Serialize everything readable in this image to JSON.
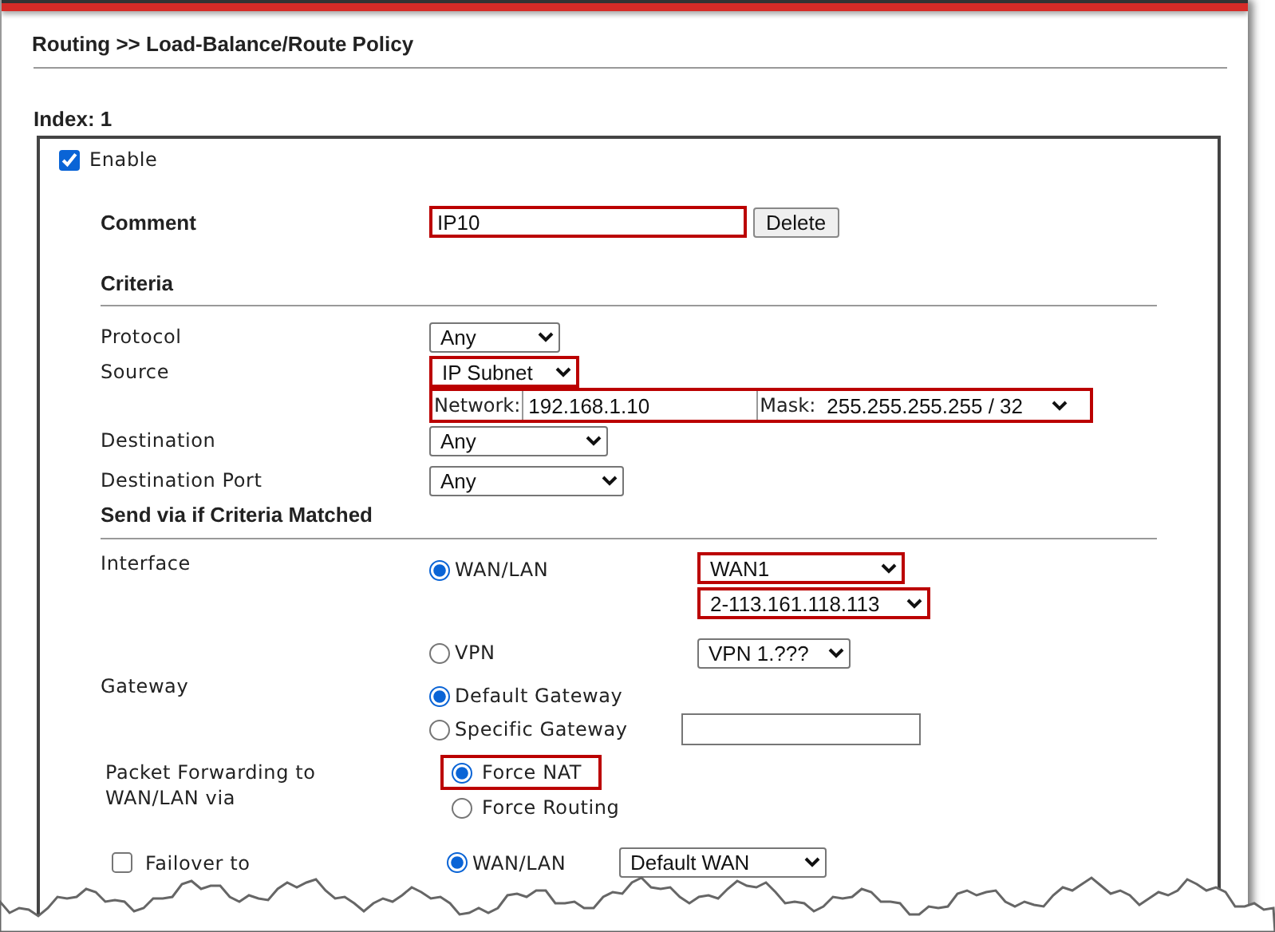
{
  "header": {
    "title": "Routing >> Load-Balance/Route Policy"
  },
  "index_label": "Index: 1",
  "enable": {
    "label": "Enable",
    "checked": true
  },
  "comment": {
    "label": "Comment",
    "value": "IP10",
    "highlighted": true,
    "button": "Delete"
  },
  "criteria": {
    "heading": "Criteria",
    "protocol": {
      "label": "Protocol",
      "value": "Any",
      "highlighted": false
    },
    "source": {
      "label": "Source",
      "value": "IP Subnet",
      "highlighted": true
    },
    "network": {
      "label": "Network:",
      "value": "192.168.1.10",
      "mask_label": "Mask:",
      "mask_value": "255.255.255.255 / 32",
      "highlighted": true
    },
    "destination": {
      "label": "Destination",
      "value": "Any",
      "highlighted": false
    },
    "destination_port": {
      "label": "Destination Port",
      "value": "Any",
      "highlighted": false
    }
  },
  "send_via": {
    "heading": "Send via if Criteria Matched",
    "interface": {
      "label": "Interface",
      "options": [
        {
          "label": "WAN/LAN",
          "selected": true,
          "selects": [
            {
              "value": "WAN1",
              "highlighted": true
            },
            {
              "value": "2-113.161.118.113",
              "highlighted": true
            }
          ]
        },
        {
          "label": "VPN",
          "selected": false,
          "selects": [
            {
              "value": "VPN 1.???",
              "highlighted": false
            }
          ]
        }
      ]
    },
    "gateway": {
      "label": "Gateway",
      "options": [
        {
          "label": "Default Gateway",
          "selected": true
        },
        {
          "label": "Specific Gateway",
          "selected": false
        }
      ]
    },
    "packet_forwarding": {
      "label": "Packet Forwarding to WAN/LAN via",
      "options": [
        {
          "label": "Force NAT",
          "selected": true,
          "highlighted": true
        },
        {
          "label": "Force Routing",
          "selected": false,
          "highlighted": false
        }
      ]
    },
    "failover": {
      "label": "Failover to",
      "checked": false,
      "option": {
        "label": "WAN/LAN",
        "selected": true
      },
      "select": {
        "value": "Default WAN",
        "highlighted": false
      }
    }
  }
}
